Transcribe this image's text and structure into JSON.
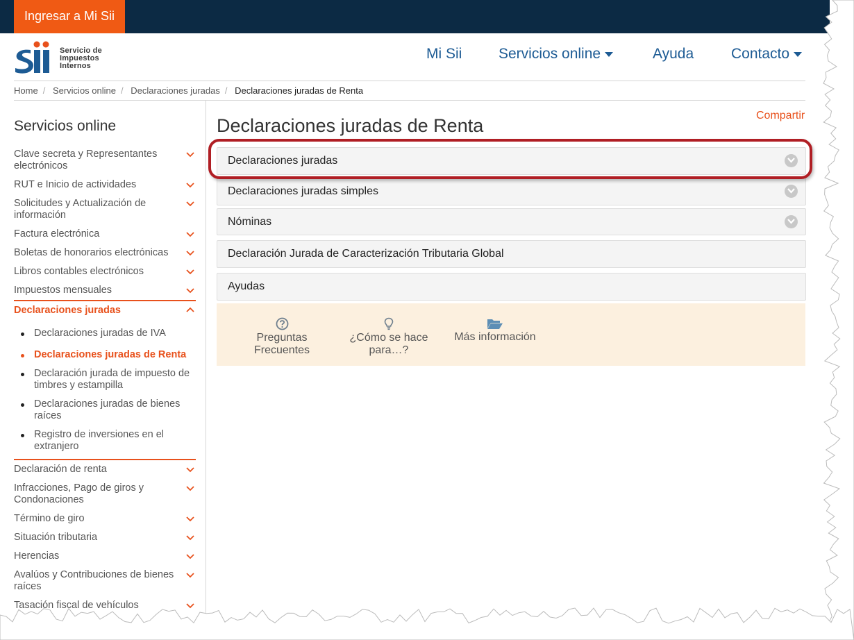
{
  "topbar": {
    "login_label": "Ingresar a Mi Sii"
  },
  "logo": {
    "mark_text": "Sii",
    "line1": "Servicio de",
    "line2": "Impuestos",
    "line3": "Internos"
  },
  "nav": {
    "items": [
      {
        "label": "Mi Sii",
        "has_dropdown": false
      },
      {
        "label": "Servicios online",
        "has_dropdown": true
      },
      {
        "label": "Ayuda",
        "has_dropdown": false
      },
      {
        "label": "Contacto",
        "has_dropdown": true
      }
    ]
  },
  "breadcrumb": [
    "Home",
    "Servicios online",
    "Declaraciones juradas",
    "Declaraciones juradas de Renta"
  ],
  "sidebar": {
    "title": "Servicios online",
    "items": [
      {
        "label": "Clave secreta y Representantes electrónicos"
      },
      {
        "label": "RUT e Inicio de actividades"
      },
      {
        "label": "Solicitudes y Actualización de información"
      },
      {
        "label": "Factura electrónica"
      },
      {
        "label": "Boletas de honorarios electrónicas"
      },
      {
        "label": "Libros contables electrónicos"
      },
      {
        "label": "Impuestos mensuales"
      },
      {
        "label": "Declaraciones juradas",
        "active": true
      },
      {
        "label": "Declaración de renta"
      },
      {
        "label": "Infracciones, Pago de giros y Condonaciones"
      },
      {
        "label": "Término de giro"
      },
      {
        "label": "Situación tributaria"
      },
      {
        "label": "Herencias"
      },
      {
        "label": "Avalúos y Contribuciones de bienes raíces"
      },
      {
        "label": "Tasación fiscal de vehículos"
      }
    ],
    "subitems": [
      {
        "label": "Declaraciones juradas de IVA"
      },
      {
        "label": "Declaraciones juradas de Renta",
        "active": true
      },
      {
        "label": "Declaración jurada de impuesto de timbres y estampilla"
      },
      {
        "label": "Declaraciones juradas de bienes raíces"
      },
      {
        "label": "Registro de inversiones en el extranjero"
      }
    ]
  },
  "main": {
    "share_label": "Compartir",
    "title": "Declaraciones juradas de Renta",
    "accordions": [
      {
        "label": "Declaraciones juradas",
        "expandable": true,
        "highlighted": true
      },
      {
        "label": "Declaraciones juradas simples",
        "expandable": true
      },
      {
        "label": "Nóminas",
        "expandable": true
      },
      {
        "label": "Declaración Jurada de Caracterización Tributaria Global",
        "expandable": false
      },
      {
        "label": "Ayudas",
        "expandable": false
      }
    ],
    "help_links": [
      {
        "label_line1": "Preguntas",
        "label_line2": "Frecuentes",
        "icon": "question-circle-icon"
      },
      {
        "label_line1": "¿Cómo se hace",
        "label_line2": "para…?",
        "icon": "lightbulb-icon"
      },
      {
        "label_line1": "Más información",
        "label_line2": "",
        "icon": "folder-open-icon"
      }
    ]
  },
  "colors": {
    "topbar": "#0c2a44",
    "accent_orange": "#e8511c",
    "login_button": "#f05a14",
    "nav_blue": "#1d5b94",
    "highlight_red": "#b01e24",
    "help_bg": "#fcf0df"
  }
}
